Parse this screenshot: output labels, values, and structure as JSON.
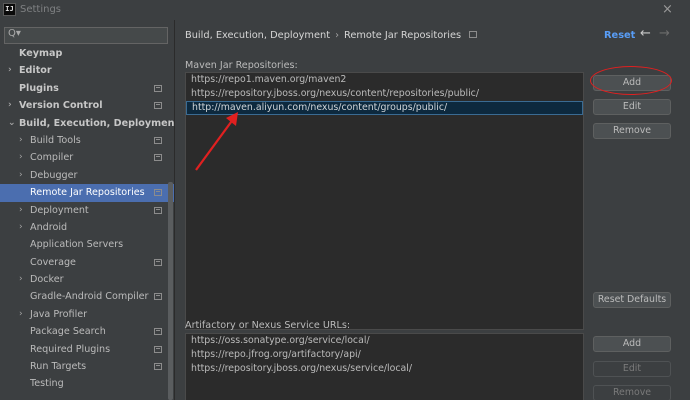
{
  "window": {
    "icon_text": "IJ",
    "title": "Settings",
    "close_glyph": "×"
  },
  "sidebar": {
    "search": {
      "value": "",
      "placeholder": "",
      "icon": "search-icon",
      "glyph": "Q▾"
    },
    "items": [
      {
        "label": "Keymap",
        "bold": true,
        "arrow": "",
        "proj": false
      },
      {
        "label": "Editor",
        "bold": true,
        "arrow": "›",
        "proj": false
      },
      {
        "label": "Plugins",
        "bold": true,
        "arrow": "",
        "proj": true
      },
      {
        "label": "Version Control",
        "bold": true,
        "arrow": "›",
        "proj": true
      },
      {
        "label": "Build, Execution, Deployment",
        "bold": true,
        "arrow": "⌄",
        "proj": false
      },
      {
        "label": "Build Tools",
        "bold": false,
        "arrow": "›",
        "proj": true
      },
      {
        "label": "Compiler",
        "bold": false,
        "arrow": "›",
        "proj": true
      },
      {
        "label": "Debugger",
        "bold": false,
        "arrow": "›",
        "proj": false
      },
      {
        "label": "Remote Jar Repositories",
        "bold": false,
        "arrow": "",
        "proj": true,
        "selected": true
      },
      {
        "label": "Deployment",
        "bold": false,
        "arrow": "›",
        "proj": true
      },
      {
        "label": "Android",
        "bold": false,
        "arrow": "›",
        "proj": false
      },
      {
        "label": "Application Servers",
        "bold": false,
        "arrow": "",
        "proj": false
      },
      {
        "label": "Coverage",
        "bold": false,
        "arrow": "",
        "proj": true
      },
      {
        "label": "Docker",
        "bold": false,
        "arrow": "›",
        "proj": false
      },
      {
        "label": "Gradle-Android Compiler",
        "bold": false,
        "arrow": "",
        "proj": true
      },
      {
        "label": "Java Profiler",
        "bold": false,
        "arrow": "›",
        "proj": false
      },
      {
        "label": "Package Search",
        "bold": false,
        "arrow": "",
        "proj": true
      },
      {
        "label": "Required Plugins",
        "bold": false,
        "arrow": "",
        "proj": true
      },
      {
        "label": "Run Targets",
        "bold": false,
        "arrow": "",
        "proj": true
      },
      {
        "label": "Testing",
        "bold": false,
        "arrow": "",
        "proj": false
      }
    ]
  },
  "header": {
    "breadcrumb": [
      "Build, Execution, Deployment",
      "Remote Jar Repositories"
    ],
    "separator": "›",
    "reset_label": "Reset",
    "back_glyph": "←",
    "forward_glyph": "→"
  },
  "maven": {
    "label": "Maven Jar Repositories:",
    "items": [
      "https://repo1.maven.org/maven2",
      "https://repository.jboss.org/nexus/content/repositories/public/",
      "http://maven.aliyun.com/nexus/content/groups/public/"
    ],
    "selected_index": 2,
    "buttons": {
      "add": "Add",
      "edit": "Edit",
      "remove": "Remove",
      "reset_defaults": "Reset Defaults"
    }
  },
  "artifactory": {
    "label": "Artifactory or Nexus Service URLs:",
    "items": [
      "https://oss.sonatype.org/service/local/",
      "https://repo.jfrog.org/artifactory/api/",
      "https://repository.jboss.org/nexus/service/local/"
    ],
    "buttons": {
      "add": "Add",
      "edit": "Edit",
      "remove": "Remove"
    }
  },
  "colors": {
    "accent": "#589df6",
    "selection": "#4b6eaf",
    "annotation": "#e02020"
  }
}
